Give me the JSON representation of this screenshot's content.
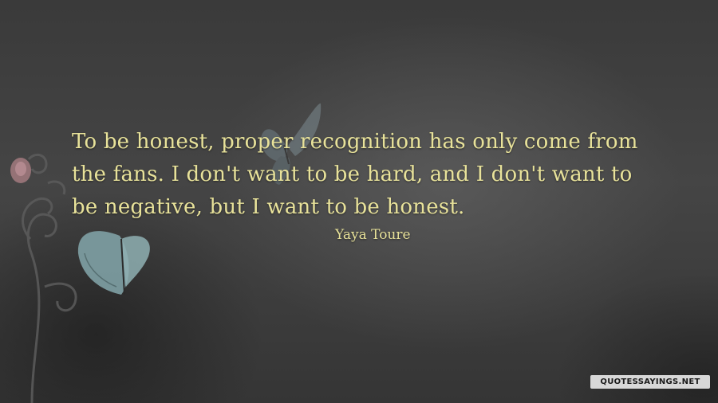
{
  "quote": {
    "text": "To be honest, proper recognition has only come from the fans. I don't want to be hard, and I don't want to be negative, but I want to be honest.",
    "author": "Yaya Toure"
  },
  "watermark": "QUOTESSAYINGS.NET",
  "colors": {
    "background": "#3c3c3c",
    "text": "#e8e29a",
    "butterfly_blue": "#7fa1a5",
    "butterfly_gray": "#6f7f86"
  },
  "decorations": [
    "butterfly-icon",
    "butterfly-icon",
    "swirl-vine-icon",
    "flower-bud-icon"
  ]
}
